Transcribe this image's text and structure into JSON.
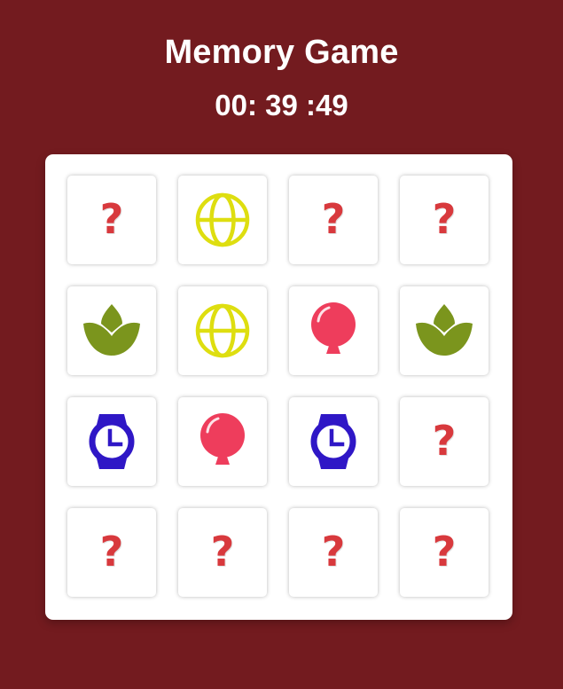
{
  "game": {
    "title": "Memory Game",
    "timer": "00: 39 :49"
  },
  "colors": {
    "background": "#731b1f",
    "question_mark": "#d8393d",
    "globe": "#dede10",
    "lotus": "#7b951d",
    "balloon": "#ee3d5c",
    "watch": "#2f17c6"
  },
  "cards": [
    {
      "state": "hidden",
      "icon": "question-mark",
      "label": "?"
    },
    {
      "state": "revealed",
      "icon": "globe-icon",
      "label": ""
    },
    {
      "state": "hidden",
      "icon": "question-mark",
      "label": "?"
    },
    {
      "state": "hidden",
      "icon": "question-mark",
      "label": "?"
    },
    {
      "state": "revealed",
      "icon": "lotus-icon",
      "label": ""
    },
    {
      "state": "revealed",
      "icon": "globe-icon",
      "label": ""
    },
    {
      "state": "revealed",
      "icon": "balloon-icon",
      "label": ""
    },
    {
      "state": "revealed",
      "icon": "lotus-icon",
      "label": ""
    },
    {
      "state": "revealed",
      "icon": "watch-icon",
      "label": ""
    },
    {
      "state": "revealed",
      "icon": "balloon-icon",
      "label": ""
    },
    {
      "state": "revealed",
      "icon": "watch-icon",
      "label": ""
    },
    {
      "state": "hidden",
      "icon": "question-mark",
      "label": "?"
    },
    {
      "state": "hidden",
      "icon": "question-mark",
      "label": "?"
    },
    {
      "state": "hidden",
      "icon": "question-mark",
      "label": "?"
    },
    {
      "state": "hidden",
      "icon": "question-mark",
      "label": "?"
    },
    {
      "state": "hidden",
      "icon": "question-mark",
      "label": "?"
    }
  ]
}
